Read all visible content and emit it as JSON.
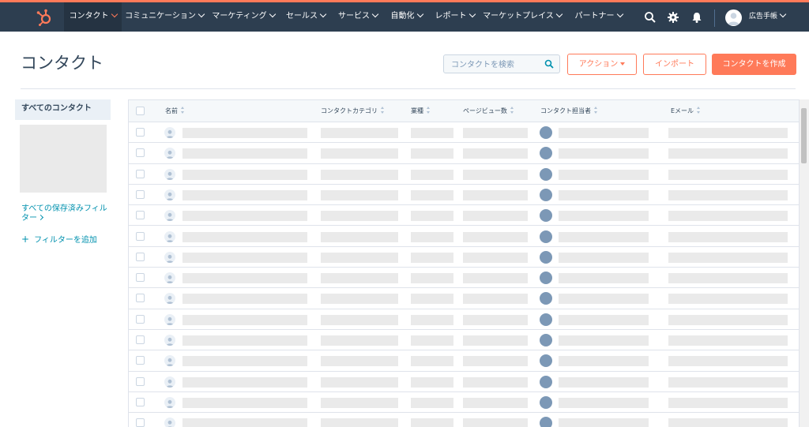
{
  "nav": {
    "logo_icon": "hubspot-sprocket-icon",
    "items": [
      {
        "label": "コンタクト",
        "active": true
      },
      {
        "label": "コミュニケーション"
      },
      {
        "label": "マーケティング"
      },
      {
        "label": "セールス"
      },
      {
        "label": "サービス"
      },
      {
        "label": "自動化"
      },
      {
        "label": "レポート"
      },
      {
        "label": "マーケットプレイス"
      },
      {
        "label": "パートナー"
      }
    ],
    "icons": [
      "search-icon",
      "gear-icon",
      "bell-icon"
    ],
    "user_name": "広告手帳"
  },
  "page": {
    "title": "コンタクト",
    "search_placeholder": "コンタクトを検索",
    "actions_label": "アクション",
    "import_label": "インポート",
    "create_label": "コンタクトを作成"
  },
  "sidebar": {
    "active_view": "すべてのコンタクト",
    "saved_filters_link": "すべての保存済みフィルター",
    "add_filter_label": "フィルターを追加"
  },
  "table": {
    "columns": [
      "名前",
      "コンタクトカテゴリ",
      "業種",
      "ページビュー数",
      "コンタクト担当者",
      "Eメール"
    ],
    "visible_rows": 15
  },
  "colors": {
    "topbar": "#2d3e50",
    "accent": "#ff7a59",
    "link": "#0091ae",
    "text": "#33475b"
  }
}
